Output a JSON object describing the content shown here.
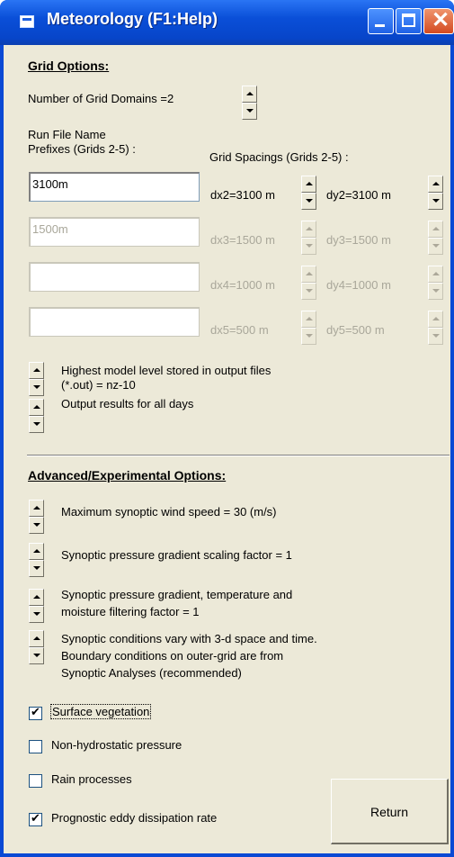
{
  "window": {
    "title": "Meteorology (F1:Help)"
  },
  "grid_options": {
    "heading": "Grid Options:",
    "domains_label": "Number of Grid Domains =2",
    "prefix_label_1": "Run File Name",
    "prefix_label_2": "Prefixes (Grids 2-5) :",
    "spacing_label": "Grid Spacings (Grids 2-5) :",
    "rows": [
      {
        "prefix": "3100m",
        "dx": "dx2=3100 m",
        "dy": "dy2=3100 m",
        "enabled": true
      },
      {
        "prefix": "1500m",
        "dx": "dx3=1500 m",
        "dy": "dy3=1500 m",
        "enabled": false
      },
      {
        "prefix": "",
        "dx": "dx4=1000 m",
        "dy": "dy4=1000 m",
        "enabled": false
      },
      {
        "prefix": "",
        "dx": "dx5=500 m",
        "dy": "dy5=500 m",
        "enabled": false
      }
    ],
    "highest_level_1": "Highest model level stored in output files",
    "highest_level_2": "(*.out) = nz-10",
    "output_days": "Output results for all days"
  },
  "advanced": {
    "heading": "Advanced/Experimental Options:",
    "max_wind": "Maximum synoptic wind speed = 30 (m/s)",
    "pressure_scaling": "Synoptic pressure gradient scaling factor = 1",
    "filter_1": "Synoptic pressure gradient, temperature and",
    "filter_2": "moisture filtering factor = 1",
    "vary_1": "Synoptic conditions vary with 3-d space and time.",
    "vary_2": "Boundary conditions on outer-grid are from",
    "vary_3": "Synoptic Analyses (recommended)",
    "checkboxes": [
      {
        "label": "Surface vegetation",
        "checked": true
      },
      {
        "label": "Non-hydrostatic pressure",
        "checked": false
      },
      {
        "label": "Rain processes",
        "checked": false
      },
      {
        "label": "Prognostic eddy dissipation rate",
        "checked": true
      }
    ]
  },
  "buttons": {
    "return_label": "Return"
  },
  "colors": {
    "titlebar": "#0a49d4",
    "panel": "#ece9d8",
    "disabled_text": "#a9a79a"
  }
}
